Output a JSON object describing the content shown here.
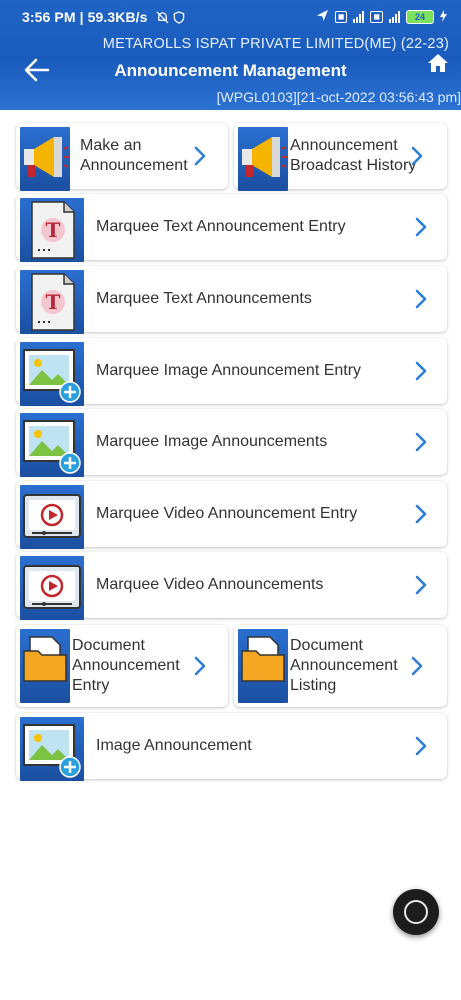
{
  "status": {
    "time_speed": "3:56 PM | 59.3KB/s",
    "battery": "24"
  },
  "header": {
    "company": "METAROLLS ISPAT PRIVATE LIMITED(ME) (22-23)",
    "title": "Announcement Management",
    "session": "[WPGL0103][21-oct-2022 03:56:43 pm]"
  },
  "menu": [
    {
      "label": "Make an Announcement",
      "icon": "megaphone-icon"
    },
    {
      "label": "Announcement Broadcast History",
      "icon": "megaphone-icon"
    },
    {
      "label": "Marquee Text Announcement Entry",
      "icon": "text-document-icon"
    },
    {
      "label": "Marquee Text Announcements",
      "icon": "text-document-icon"
    },
    {
      "label": "Marquee Image Announcement Entry",
      "icon": "image-add-icon"
    },
    {
      "label": "Marquee Image Announcements",
      "icon": "image-add-icon"
    },
    {
      "label": "Marquee Video Announcement Entry",
      "icon": "video-player-icon"
    },
    {
      "label": "Marquee Video Announcements",
      "icon": "video-player-icon"
    },
    {
      "label": "Document Announcement Entry",
      "icon": "folder-document-icon"
    },
    {
      "label": "Document Announcement Listing",
      "icon": "folder-document-icon"
    },
    {
      "label": "Image Announcement",
      "icon": "image-add-icon"
    }
  ],
  "colors": {
    "header": "#1f63c4",
    "chevron": "#2f7fd6",
    "icon_bg": "#1b4fa1"
  }
}
